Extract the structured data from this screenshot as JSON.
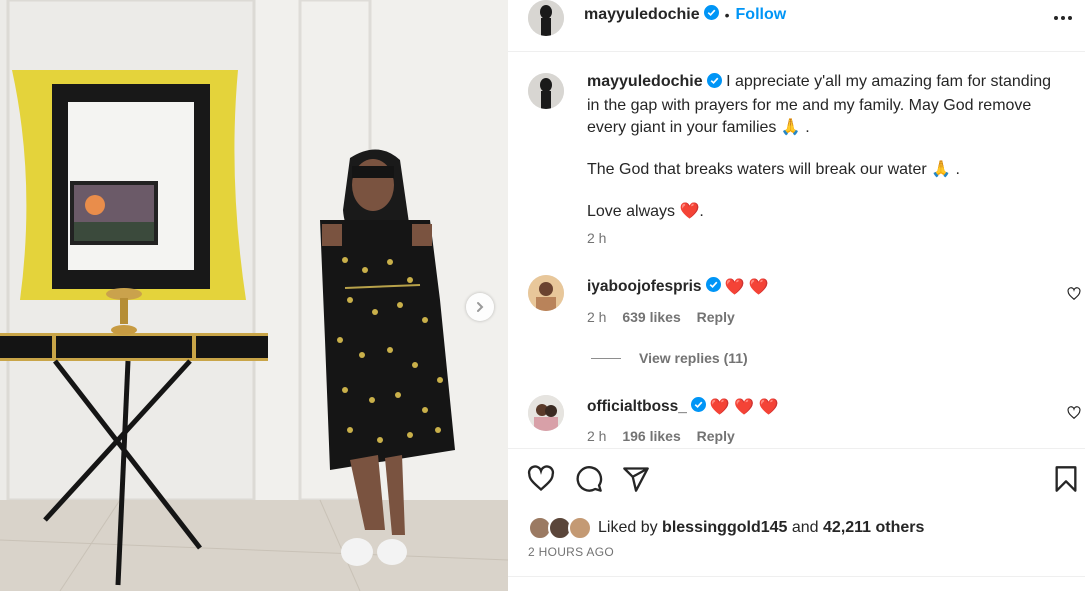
{
  "post": {
    "username": "mayyuledochie",
    "follow_label": "Follow",
    "dot": "•",
    "caption_lines": [
      "I appreciate y'all my amazing fam for standing in the gap with prayers for me and my family. May God remove every giant in your families 🙏 .",
      "The God that breaks waters will break our water 🙏 .",
      "Love always ❤️."
    ],
    "caption_time": "2 h",
    "icons": {
      "verified": "verified-badge-icon",
      "more": "more-options-icon",
      "next": "carousel-next-icon",
      "heart": "heart-icon",
      "comment": "comment-icon",
      "share": "share-icon",
      "save": "bookmark-icon"
    },
    "colors": {
      "link": "#0095f6",
      "heart": "#e0163d",
      "verified": "#0095f6"
    }
  },
  "comments": [
    {
      "username": "iyaboojofespris",
      "emojis": "❤️ ❤️",
      "time": "2 h",
      "likes": "639 likes",
      "reply_label": "Reply"
    },
    {
      "username": "officialtboss_",
      "emojis": "❤️ ❤️ ❤️",
      "time": "2 h",
      "likes": "196 likes",
      "reply_label": "Reply"
    }
  ],
  "view_replies": "View replies (11)",
  "likes_summary": {
    "prefix": "Liked by ",
    "user": "blessinggold145",
    "middle": " and ",
    "count": "42,211 others"
  },
  "timestamp": "2 HOURS AGO"
}
